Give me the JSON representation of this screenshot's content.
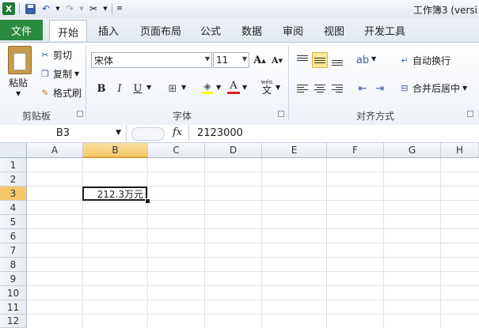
{
  "window": {
    "title": "工作簿3 (versi"
  },
  "quick_access": {
    "icons": [
      "excel-logo",
      "save-icon",
      "undo-icon",
      "redo-icon",
      "customize-icon"
    ]
  },
  "tabs": {
    "file": "文件",
    "items": [
      "开始",
      "插入",
      "页面布局",
      "公式",
      "数据",
      "审阅",
      "视图",
      "开发工具"
    ],
    "active": "开始"
  },
  "ribbon": {
    "clipboard": {
      "paste": "粘贴",
      "cut": "剪切",
      "copy": "复制",
      "format_painter": "格式刷",
      "label": "剪贴板"
    },
    "font": {
      "name": "宋体",
      "size": "11",
      "bold": "B",
      "italic": "I",
      "underline": "U",
      "wen": "wén",
      "wen_char": "文",
      "grow": "A",
      "shrink": "A",
      "font_color": "A",
      "label": "字体"
    },
    "alignment": {
      "wrap_text": "自动换行",
      "merge_center": "合并后居中",
      "label": "对齐方式"
    }
  },
  "formula_bar": {
    "name_box": "B3",
    "fx": "fx",
    "content": "2123000"
  },
  "grid": {
    "columns": [
      "A",
      "B",
      "C",
      "D",
      "E",
      "F",
      "G",
      "H"
    ],
    "rows": [
      "1",
      "2",
      "3",
      "4",
      "5",
      "6",
      "7",
      "8",
      "9",
      "10",
      "11",
      "12"
    ],
    "selected_column": "B",
    "selected_row": "3",
    "active_cell": {
      "ref": "B3",
      "display": "212.3万元"
    }
  }
}
